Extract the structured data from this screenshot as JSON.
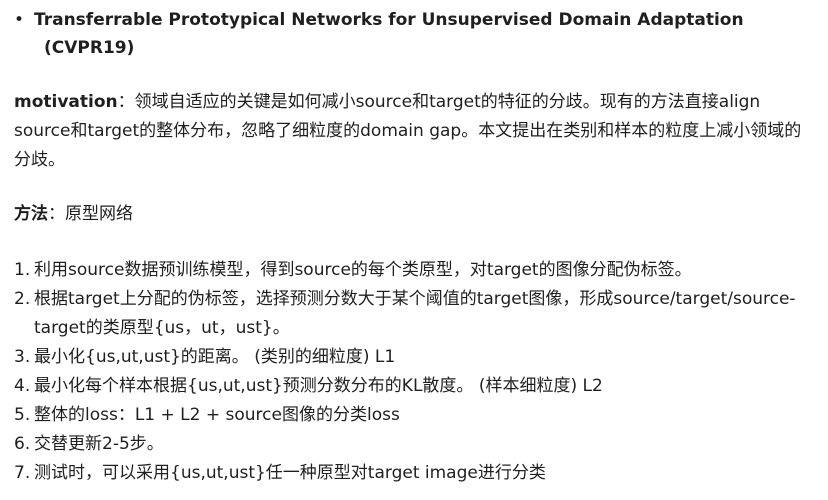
{
  "heading": {
    "bullet": "•",
    "line1": "Transferrable Prototypical Networks for Unsupervised Domain Adaptation",
    "line2": "(CVPR19)"
  },
  "motivation": {
    "label": "motivation",
    "separator": "：",
    "text": "领域自适应的关键是如何减小source和target的特征的分歧。现有的方法直接align source和target的整体分布，忽略了细粒度的domain gap。本文提出在类别和样本的粒度上减小领域的分歧。"
  },
  "method": {
    "label": "方法",
    "separator": "：",
    "text": "原型网络"
  },
  "steps": [
    {
      "num": "1.",
      "text": "利用source数据预训练模型，得到source的每个类原型，对target的图像分配伪标签。"
    },
    {
      "num": "2.",
      "text": "根据target上分配的伪标签，选择预测分数大于某个阈值的target图像，形成source/target/source-target的类原型{us，ut，ust}。"
    },
    {
      "num": "3.",
      "text": "最小化{us,ut,ust}的距离。 (类别的细粒度) L1"
    },
    {
      "num": "4.",
      "text": "最小化每个样本根据{us,ut,ust}预测分数分布的KL散度。 (样本细粒度)  L2"
    },
    {
      "num": "5.",
      "text": "整体的loss：L1 + L2 + source图像的分类loss"
    },
    {
      "num": "6.",
      "text": "交替更新2-5步。"
    },
    {
      "num": "7.",
      "text": "测试时，可以采用{us,ut,ust}任一种原型对target image进行分类"
    }
  ]
}
